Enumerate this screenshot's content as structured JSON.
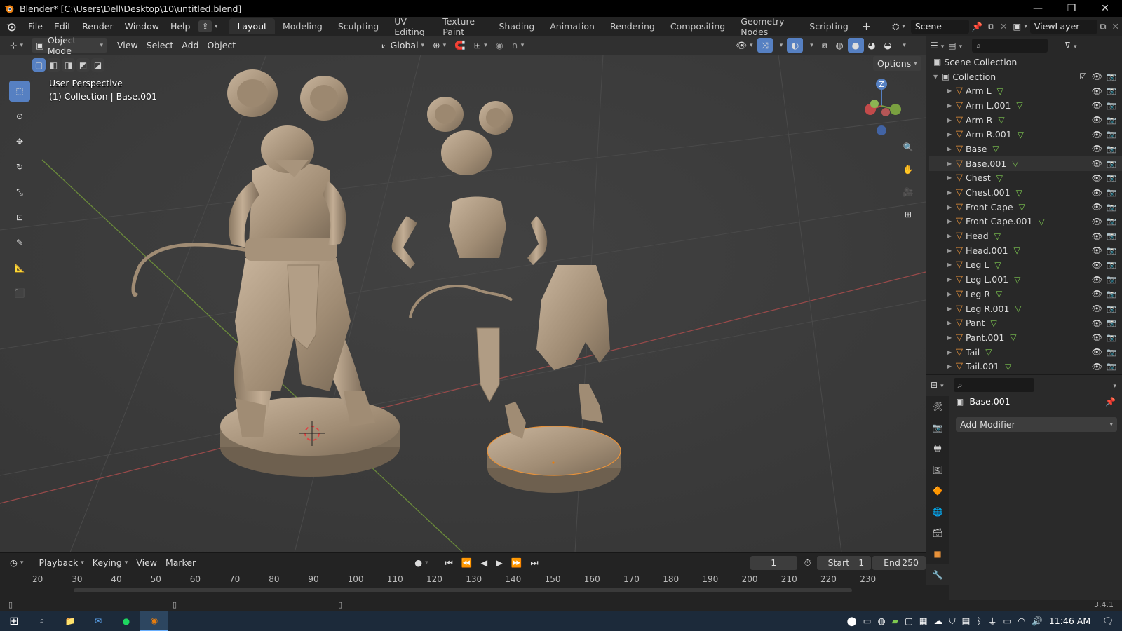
{
  "window": {
    "title": "Blender* [C:\\Users\\Dell\\Desktop\\10\\untitled.blend]",
    "minimize": "—",
    "maximize": "❐",
    "close": "✕"
  },
  "menus": [
    "File",
    "Edit",
    "Render",
    "Window",
    "Help"
  ],
  "workspaces": [
    "Layout",
    "Modeling",
    "Sculpting",
    "UV Editing",
    "Texture Paint",
    "Shading",
    "Animation",
    "Rendering",
    "Compositing",
    "Geometry Nodes",
    "Scripting"
  ],
  "active_workspace": "Layout",
  "scene": {
    "name": "Scene",
    "view_layer": "ViewLayer"
  },
  "viewport_header": {
    "mode": "Object Mode",
    "menus": [
      "View",
      "Select",
      "Add",
      "Object"
    ],
    "transform_orientation": "Global",
    "options_label": "Options"
  },
  "viewport_overlay": {
    "view_name": "User Perspective",
    "context": "(1) Collection | Base.001"
  },
  "gizmo": {
    "axis_z": "Z",
    "axis_y": "Y",
    "axis_x": "X"
  },
  "outliner": {
    "root": "Scene Collection",
    "collection": "Collection",
    "items": [
      "Arm L",
      "Arm L.001",
      "Arm R",
      "Arm R.001",
      "Base",
      "Base.001",
      "Chest",
      "Chest.001",
      "Front Cape",
      "Front Cape.001",
      "Head",
      "Head.001",
      "Leg L",
      "Leg L.001",
      "Leg R",
      "Leg R.001",
      "Pant",
      "Pant.001",
      "Tail",
      "Tail.001"
    ],
    "selected": "Base.001"
  },
  "properties": {
    "object_name": "Base.001",
    "add_modifier": "Add Modifier"
  },
  "timeline": {
    "menus": [
      "Playback",
      "Keying",
      "View",
      "Marker"
    ],
    "current_frame": "1",
    "start_label": "Start",
    "start": "1",
    "end_label": "End",
    "end": "250",
    "ruler": [
      "20",
      "30",
      "40",
      "50",
      "60",
      "70",
      "80",
      "90",
      "100",
      "110",
      "120",
      "130",
      "140",
      "150",
      "160",
      "170",
      "180",
      "190",
      "200",
      "210",
      "220",
      "230"
    ]
  },
  "status": {
    "version": "3.4.1"
  },
  "taskbar": {
    "time": "11:46 AM"
  },
  "colors": {
    "accent": "#5680c2",
    "active_orange": "#e87d0d",
    "mesh_icon": "#e8923a",
    "vertex_green": "#7ec850"
  }
}
